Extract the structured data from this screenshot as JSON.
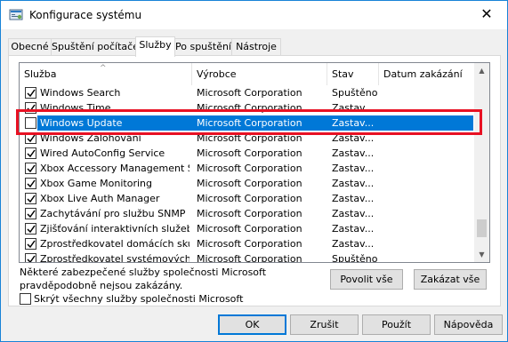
{
  "window": {
    "title": "Konfigurace systému",
    "close_icon": "close-icon"
  },
  "tabs": [
    {
      "label": "Obecné",
      "active": false
    },
    {
      "label": "Spuštění počítače",
      "active": false
    },
    {
      "label": "Služby",
      "active": true
    },
    {
      "label": "Po spuštění",
      "active": false
    },
    {
      "label": "Nástroje",
      "active": false
    }
  ],
  "services": {
    "columns": {
      "name": "Služba",
      "manufacturer": "Výrobce",
      "status": "Stav",
      "disabled_date": "Datum zakázání"
    },
    "rows": [
      {
        "checked": true,
        "name": "Windows Search",
        "manufacturer": "Microsoft Corporation",
        "status": "Spuštěno",
        "date": ""
      },
      {
        "checked": true,
        "name": "Windows Time",
        "manufacturer": "Microsoft Corporation",
        "status": "Zastav...",
        "date": ""
      },
      {
        "checked": false,
        "name": "Windows Update",
        "manufacturer": "Microsoft Corporation",
        "status": "Zastav...",
        "date": "",
        "selected": true
      },
      {
        "checked": true,
        "name": "Windows Zálohování",
        "manufacturer": "Microsoft Corporation",
        "status": "Zastav...",
        "date": ""
      },
      {
        "checked": true,
        "name": "Wired AutoConfig Service",
        "manufacturer": "Microsoft Corporation",
        "status": "Zastav...",
        "date": ""
      },
      {
        "checked": true,
        "name": "Xbox Accessory Management Se...",
        "manufacturer": "Microsoft Corporation",
        "status": "Zastav...",
        "date": ""
      },
      {
        "checked": true,
        "name": "Xbox Game Monitoring",
        "manufacturer": "Microsoft Corporation",
        "status": "Zastav...",
        "date": ""
      },
      {
        "checked": true,
        "name": "Xbox Live Auth Manager",
        "manufacturer": "Microsoft Corporation",
        "status": "Zastav...",
        "date": ""
      },
      {
        "checked": true,
        "name": "Zachytávání pro službu SNMP",
        "manufacturer": "Microsoft Corporation",
        "status": "Zastav...",
        "date": ""
      },
      {
        "checked": true,
        "name": "Zjišťování interaktivních služeb",
        "manufacturer": "Microsoft Corporation",
        "status": "Zastav...",
        "date": ""
      },
      {
        "checked": true,
        "name": "Zprostředkovatel domácích skupin",
        "manufacturer": "Microsoft Corporation",
        "status": "Zastav...",
        "date": ""
      },
      {
        "checked": true,
        "name": "Zprostředkovatel systémových u...",
        "manufacturer": "Microsoft Corporation",
        "status": "Spuštěno",
        "date": ""
      }
    ],
    "highlight_color": "#e81123",
    "selection_color": "#0078d7"
  },
  "note": "Některé zabezpečené služby společnosti Microsoft pravděpodobně nejsou zakázány.",
  "enable_all_label": "Povolit vše",
  "disable_all_label": "Zakázat vše",
  "hide_microsoft": {
    "label": "Skrýt všechny služby společnosti Microsoft",
    "checked": false
  },
  "buttons": {
    "ok": "OK",
    "cancel": "Zrušit",
    "apply": "Použít",
    "help": "Nápověda"
  }
}
